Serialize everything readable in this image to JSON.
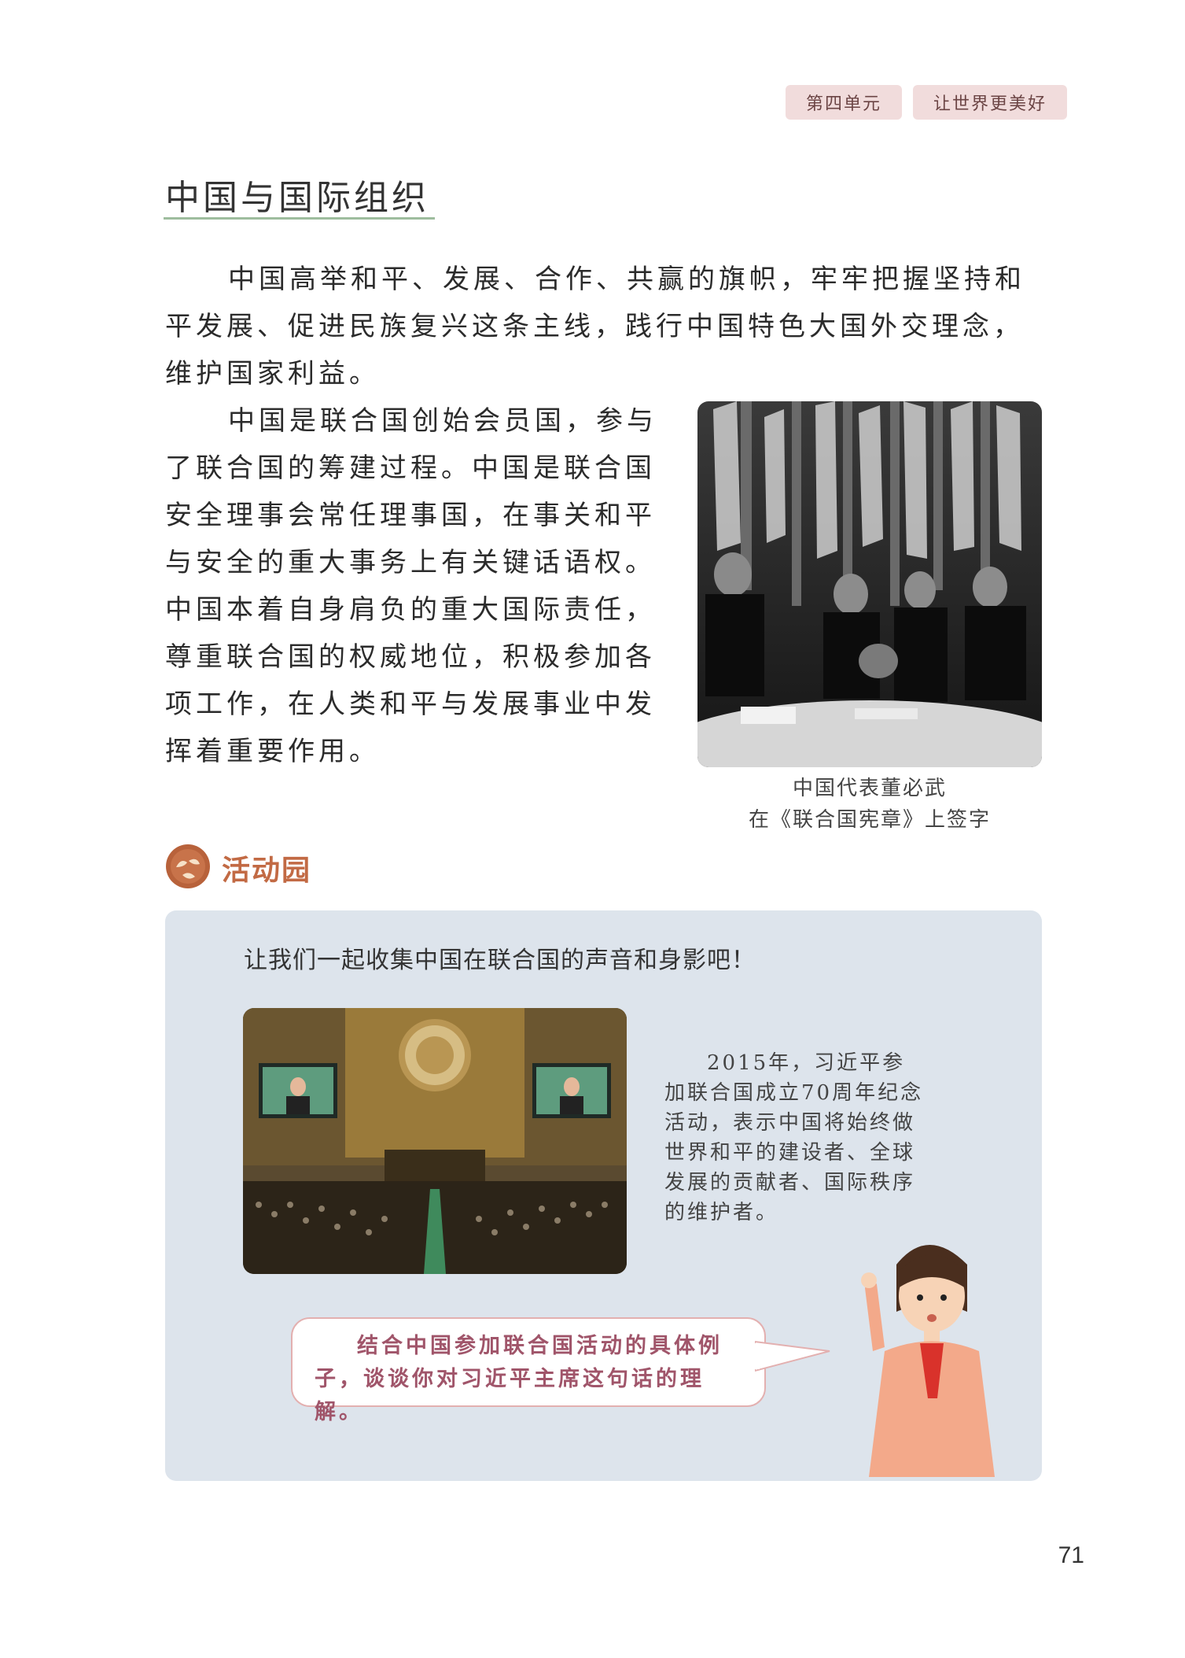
{
  "header": {
    "unit": "第四单元",
    "unit_title": "让世界更美好"
  },
  "section_title": "中国与国际组织",
  "paragraphs": {
    "p1": "中国高举和平、发展、合作、共赢的旗帜，牢牢把握坚持和平发展、促进民族复兴这条主线，践行中国特色大国外交理念，维护国家利益。",
    "p2": "中国是联合国创始会员国，参与了联合国的筹建过程。中国是联合国安全理事会常任理事国，在事关和平与安全的重大事务上有关键话语权。中国本着自身肩负的重大国际责任，尊重联合国的权威地位，积极参加各项工作，在人类和平与发展事业中发挥着重要作用。"
  },
  "photo1": {
    "caption_line1": "中国代表董必武",
    "caption_line2": "在《联合国宪章》上签字"
  },
  "activity": {
    "title": "活动园",
    "prompt": "让我们一起收集中国在联合国的声音和身影吧！",
    "side_text": "2015年，习近平参加联合国成立70周年纪念活动，表示中国将始终做世界和平的建设者、全球发展的贡献者、国际秩序的维护者。",
    "bubble_text": "结合中国参加联合国活动的具体例子，谈谈你对习近平主席这句话的理解。"
  },
  "page_number": "71",
  "colors": {
    "tag_bg": "#f1dcdc",
    "activity_title": "#c26a44",
    "activity_bg": "#dde4ec",
    "bubble_text": "#a0556a",
    "underline": "#9ebd9e"
  }
}
